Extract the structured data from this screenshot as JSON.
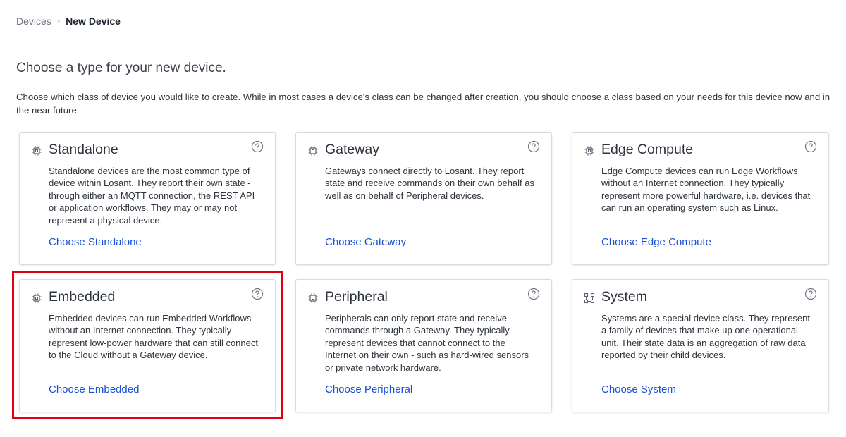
{
  "breadcrumb": {
    "parent": "Devices",
    "separator": "›",
    "current": "New Device"
  },
  "heading": "Choose a type for your new device.",
  "intro": "Choose which class of device you would like to create. While in most cases a device's class can be changed after creation, you should choose a class based on your needs for this device now and in the near future.",
  "cards": [
    {
      "title": "Standalone",
      "icon": "chip-icon",
      "description": "Standalone devices are the most common type of device within Losant. They report their own state - through either an MQTT connection, the REST API or application workflows. They may or may not represent a physical device.",
      "action": "Choose Standalone"
    },
    {
      "title": "Gateway",
      "icon": "chip-icon",
      "description": "Gateways connect directly to Losant. They report state and receive commands on their own behalf as well as on behalf of Peripheral devices.",
      "action": "Choose Gateway"
    },
    {
      "title": "Edge Compute",
      "icon": "chip-icon",
      "description": "Edge Compute devices can run Edge Workflows without an Internet connection. They typically represent more powerful hardware, i.e. devices that can run an operating system such as Linux.",
      "action": "Choose Edge Compute"
    },
    {
      "title": "Embedded",
      "icon": "chip-icon",
      "description": "Embedded devices can run Embedded Workflows without an Internet connection. They typically represent low-power hardware that can still connect to the Cloud without a Gateway device.",
      "action": "Choose Embedded"
    },
    {
      "title": "Peripheral",
      "icon": "chip-icon",
      "description": "Peripherals can only report state and receive commands through a Gateway. They typically represent devices that cannot connect to the Internet on their own - such as hard-wired sensors or private network hardware.",
      "action": "Choose Peripheral"
    },
    {
      "title": "System",
      "icon": "system-nodes-icon",
      "description": "Systems are a special device class. They represent a family of devices that make up one operational unit. Their state data is an aggregation of raw data reported by their child devices.",
      "action": "Choose System"
    }
  ],
  "colors": {
    "accent": "#1a4fd6",
    "highlight": "#e1000f",
    "border": "#d8dce1"
  }
}
